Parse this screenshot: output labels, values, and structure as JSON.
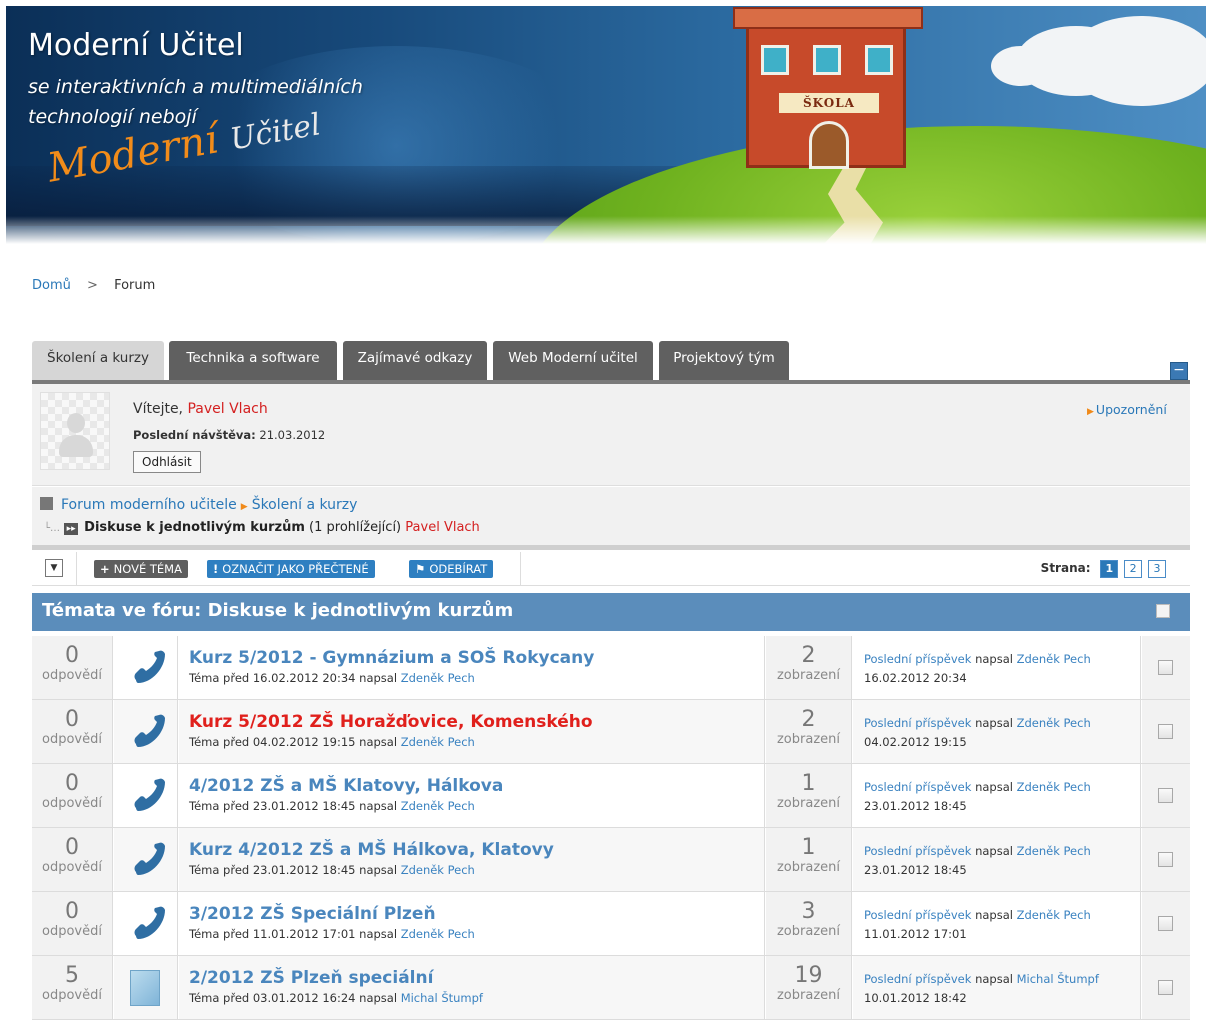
{
  "header": {
    "title": "Moderní Učitel",
    "subtitle_line1": "se interaktivních a multimediálních",
    "subtitle_line2": "technologií nebojí",
    "logo_part1": "Moderní",
    "logo_part2": "Učitel",
    "school_sign": "ŠKOLA"
  },
  "breadcrumb": {
    "home": "Domů",
    "separator": ">",
    "current": "Forum"
  },
  "tabs": [
    {
      "label": "Školení a kurzy",
      "active": true
    },
    {
      "label": "Technika a software",
      "active": false
    },
    {
      "label": "Zajímavé odkazy",
      "active": false
    },
    {
      "label": "Web Moderní učitel",
      "active": false
    },
    {
      "label": "Projektový tým",
      "active": false
    }
  ],
  "user": {
    "welcome": "Vítejte,",
    "name": "Pavel Vlach",
    "last_visit_label": "Poslední návštěva:",
    "last_visit_value": "21.03.2012",
    "logout": "Odhlásit",
    "notifications": "Upozornění"
  },
  "forum_path": {
    "root": "Forum moderního učitele",
    "category": "Školení a kurzy",
    "current": "Diskuse k jednotlivým kurzům",
    "viewers": "(1 prohlížející)",
    "viewer_name": "Pavel Vlach"
  },
  "toolbar": {
    "new_topic": "Nové téma",
    "mark_read": "Označit jako přečtené",
    "subscribe": "Odebírat",
    "page_label": "Strana:",
    "pages": [
      "1",
      "2",
      "3"
    ],
    "current_page": "1"
  },
  "list": {
    "title": "Témata ve fóru: Diskuse k jednotlivým kurzům",
    "topics": [
      {
        "replies": "0",
        "replies_label": "odpovědí",
        "icon": "phone-icon",
        "title": "Kurz 5/2012 - Gymnázium a SOŠ Rokycany",
        "red": false,
        "meta_prefix": "Téma před 16.02.2012 20:34 napsal",
        "author": "Zdeněk Pech",
        "views": "2",
        "views_label": "zobrazení",
        "last_link": "Poslední příspěvek",
        "last_by": "napsal",
        "last_author": "Zdeněk Pech",
        "last_date": "16.02.2012 20:34"
      },
      {
        "replies": "0",
        "replies_label": "odpovědí",
        "icon": "phone-icon",
        "title": "Kurz 5/2012 ZŠ Horažďovice, Komenského",
        "red": true,
        "meta_prefix": "Téma před 04.02.2012 19:15 napsal",
        "author": "Zdeněk Pech",
        "views": "2",
        "views_label": "zobrazení",
        "last_link": "Poslední příspěvek",
        "last_by": "napsal",
        "last_author": "Zdeněk Pech",
        "last_date": "04.02.2012 19:15"
      },
      {
        "replies": "0",
        "replies_label": "odpovědí",
        "icon": "phone-icon",
        "title": "4/2012 ZŠ a MŠ Klatovy, Hálkova",
        "red": false,
        "meta_prefix": "Téma před 23.01.2012 18:45 napsal",
        "author": "Zdeněk Pech",
        "views": "1",
        "views_label": "zobrazení",
        "last_link": "Poslední příspěvek",
        "last_by": "napsal",
        "last_author": "Zdeněk Pech",
        "last_date": "23.01.2012 18:45"
      },
      {
        "replies": "0",
        "replies_label": "odpovědí",
        "icon": "phone-icon",
        "title": "Kurz 4/2012 ZŠ a MŠ Hálkova, Klatovy",
        "red": false,
        "meta_prefix": "Téma před 23.01.2012 18:45 napsal",
        "author": "Zdeněk Pech",
        "views": "1",
        "views_label": "zobrazení",
        "last_link": "Poslední příspěvek",
        "last_by": "napsal",
        "last_author": "Zdeněk Pech",
        "last_date": "23.01.2012 18:45"
      },
      {
        "replies": "0",
        "replies_label": "odpovědí",
        "icon": "phone-icon",
        "title": "3/2012 ZŠ Speciální Plzeň",
        "red": false,
        "meta_prefix": "Téma před 11.01.2012 17:01 napsal",
        "author": "Zdeněk Pech",
        "views": "3",
        "views_label": "zobrazení",
        "last_link": "Poslední příspěvek",
        "last_by": "napsal",
        "last_author": "Zdeněk Pech",
        "last_date": "11.01.2012 17:01"
      },
      {
        "replies": "5",
        "replies_label": "odpovědí",
        "icon": "file-icon",
        "title": "2/2012 ZŠ Plzeň speciální",
        "red": false,
        "meta_prefix": "Téma před 03.01.2012 16:24 napsal",
        "author": "Michal Štumpf",
        "views": "19",
        "views_label": "zobrazení",
        "last_link": "Poslední příspěvek",
        "last_by": "napsal",
        "last_author": "Michal Štumpf",
        "last_date": "10.01.2012 18:42"
      }
    ]
  },
  "colors": {
    "link": "#2a78b8",
    "accent_red": "#d42020",
    "header_bar": "#5b8dbb",
    "tab_dark": "#606060",
    "tab_active": "#d6d6d6",
    "toolbar_blue": "#2e7fc1"
  }
}
